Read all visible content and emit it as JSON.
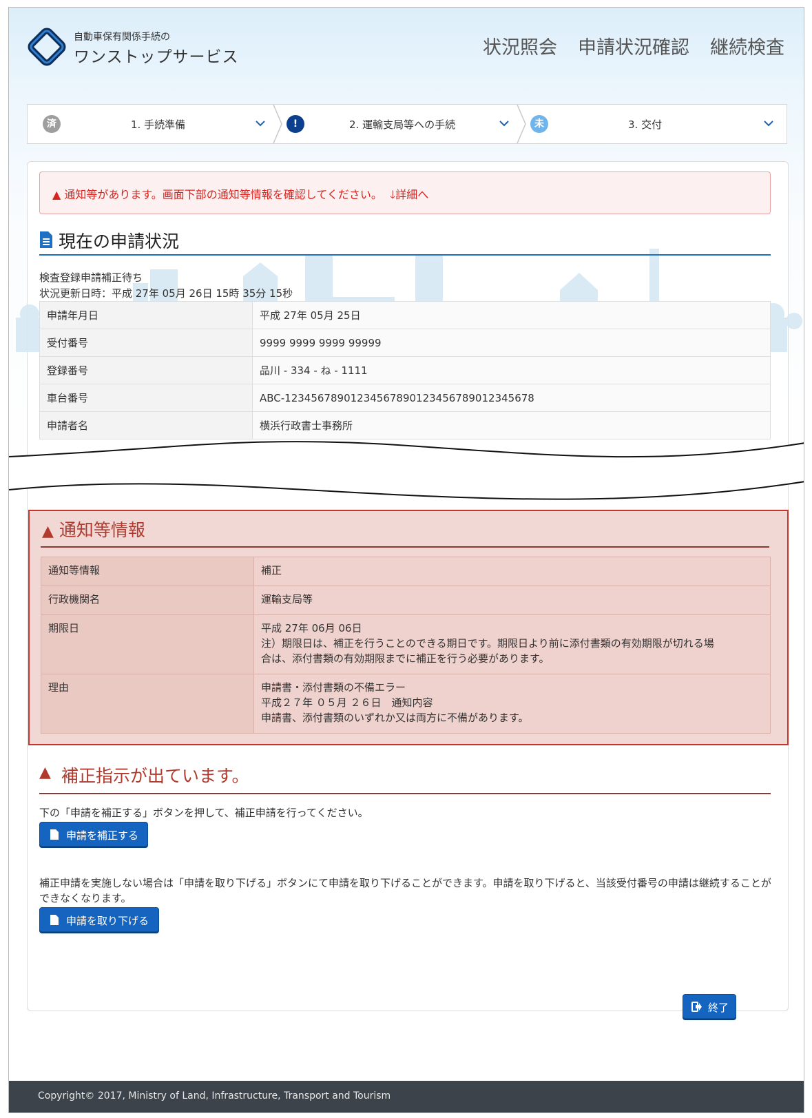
{
  "header": {
    "brand_sub": "自動車保有関係手続の",
    "brand_main": "ワンストップサービス",
    "nav": [
      "状況照会",
      "申請状況確認",
      "継続検査"
    ]
  },
  "steps": [
    {
      "badge": "済",
      "label": "1. 手続準備",
      "badge_color": "#9e9e9e"
    },
    {
      "badge": "!",
      "label": "2. 運輸支局等への手続",
      "badge_color": "#0d3f8f"
    },
    {
      "badge": "未",
      "label": "3. 交付",
      "badge_color": "#6fb4ea"
    }
  ],
  "alert": {
    "text": "通知等があります。画面下部の通知等情報を確認してください。",
    "link": "詳細へ"
  },
  "status": {
    "title": "現在の申請状況",
    "state": "検査登録申請補正待ち",
    "updated": "状況更新日時：平成 27年 05月 26日 15時 35分 15秒",
    "rows": [
      {
        "k": "申請年月日",
        "v": "平成 27年 05月 25日"
      },
      {
        "k": "受付番号",
        "v": "9999 9999 9999 99999"
      },
      {
        "k": "登録番号",
        "v": "品川 - 334 - ね - 1111"
      },
      {
        "k": "車台番号",
        "v": "ABC-1234567890123456789012345678901234567​8"
      },
      {
        "k": "申請者名",
        "v": "横浜行政書士事務所"
      }
    ]
  },
  "notice": {
    "title": "通知等情報",
    "rows": [
      {
        "k": "通知等情報",
        "v": [
          "補正"
        ]
      },
      {
        "k": "行政機関名",
        "v": [
          "運輸支局等"
        ]
      },
      {
        "k": "期限日",
        "v": [
          "平成 27年 06月 06日",
          "注）期限日は、補正を行うことのできる期日です。期限日より前に添付書類の有効期限が切れる場",
          "合は、添付書類の有効期限までに補正を行う必要があります。"
        ]
      },
      {
        "k": "理由",
        "v": [
          "申請書・添付書類の不備エラー",
          "平成２７年 ０５月 ２６日　通知内容",
          "申請書、添付書類のいずれか又は両方に不備があります。"
        ]
      }
    ]
  },
  "correction": {
    "title": "補正指示が出ています。",
    "instruction": "下の「申請を補正する」ボタンを押して、補正申請を行ってください。",
    "correct_button": "申請を補正する",
    "withdraw_text": "補正申請を実施しない場合は「申請を取り下げる」ボタンにて申請を取り下げることができます。申請を取り下げると、当該受付番号の申請は継続することができなくなります。",
    "withdraw_button": "申請を取り下げる"
  },
  "exit_button": "終了",
  "footer": "Copyright© 2017, Ministry of Land, Infrastructure, Transport and Tourism",
  "colors": {
    "accent": "#1565c0",
    "warning": "#d9231d",
    "notice_bg": "#f1d8d5",
    "notice_border": "#c8342c",
    "footer_bg": "#3d434a"
  }
}
